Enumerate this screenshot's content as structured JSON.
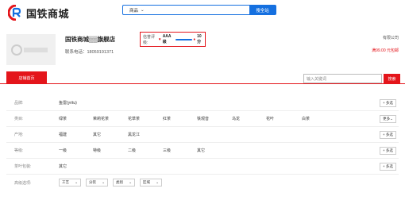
{
  "header": {
    "logo_text": "国铁商城",
    "search_category": "商品",
    "search_button": "搜全站"
  },
  "shop": {
    "name": "国铁商城▒▒旗舰店",
    "phone": "联系电话：18059191371",
    "rating_label": "信誉评级:",
    "rating_level": "AAA 级",
    "rating_score": "10 分",
    "top_right": "有限公司",
    "shipping": "满99.00 元包邮"
  },
  "nav": {
    "home": "店铺首页",
    "keyword_placeholder": "输入关键词",
    "search_button": "搜索"
  },
  "filters": {
    "rows": [
      {
        "label": "品牌:",
        "options": [
          "鱼雷(yritu)"
        ],
        "more": "+ 多选"
      },
      {
        "label": "类目:",
        "options": [
          "绿茶",
          "茉莉花茶",
          "花草茶",
          "红茶",
          "铁观音",
          "乌龙",
          "花叶",
          "白茶"
        ],
        "more": "更多",
        "multi": "+ 多选"
      },
      {
        "label": "产地:",
        "options": [
          "福建",
          "其它",
          "黑龙江"
        ],
        "more": "+ 多选"
      },
      {
        "label": "等级:",
        "options": [
          "一级",
          "特级",
          "二级",
          "三级",
          "其它"
        ],
        "more": "+ 多选"
      },
      {
        "label": "茶叶包装:",
        "options": [
          "其它"
        ],
        "more": "+ 多选"
      },
      {
        "label": "高级选项:",
        "selects": [
          "工艺",
          "分装",
          "类别",
          "区域"
        ]
      }
    ]
  },
  "colors": {
    "primary_blue": "#1570e0",
    "accent_red": "#e4151b"
  }
}
